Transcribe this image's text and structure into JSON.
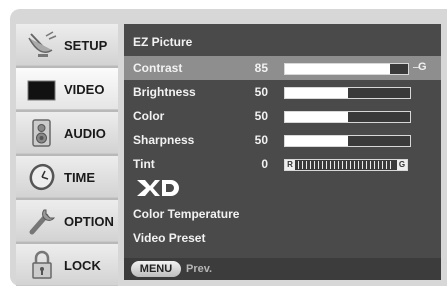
{
  "sidebar": {
    "items": [
      {
        "label": "SETUP",
        "icon": "satellite-dish-icon"
      },
      {
        "label": "VIDEO",
        "icon": "tv-screen-icon",
        "active": true
      },
      {
        "label": "AUDIO",
        "icon": "speaker-icon"
      },
      {
        "label": "TIME",
        "icon": "clock-icon"
      },
      {
        "label": "OPTION",
        "icon": "wrench-icon"
      },
      {
        "label": "LOCK",
        "icon": "padlock-icon"
      }
    ]
  },
  "menu": {
    "title": "EZ Picture",
    "contrast": {
      "label": "Contrast",
      "value": "85",
      "level": 0.85,
      "end_label": "G"
    },
    "brightness": {
      "label": "Brightness",
      "value": "50",
      "level": 0.5
    },
    "color": {
      "label": "Color",
      "value": "50",
      "level": 0.5
    },
    "sharpness": {
      "label": "Sharpness",
      "value": "50",
      "level": 0.5
    },
    "tint": {
      "label": "Tint",
      "value": "0",
      "left_label": "R",
      "right_label": "G"
    },
    "xd_logo": "XD",
    "color_temperature": "Color Temperature",
    "video_preset": "Video Preset"
  },
  "footer": {
    "menu_button": "MENU",
    "prev_label": "Prev."
  },
  "colors": {
    "panel_bg": "#4a4a4a",
    "selected_row": "#8e8e8e",
    "sidebar_bg": "#d7d7d7"
  }
}
